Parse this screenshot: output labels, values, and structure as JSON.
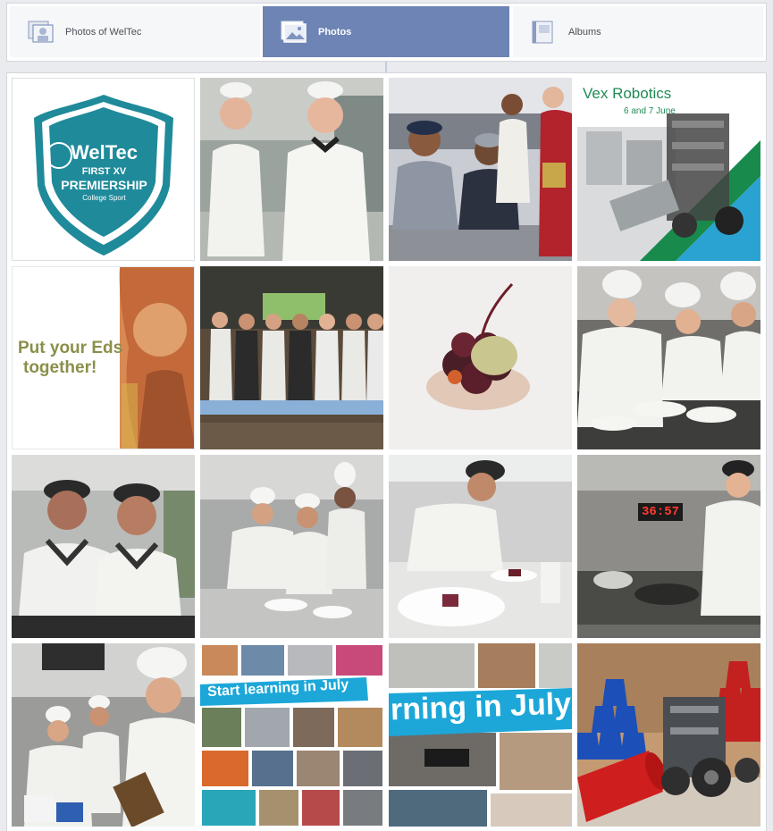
{
  "tabs": [
    {
      "label": "Photos of WelTec",
      "icon": "tagged-photos-icon",
      "active": false
    },
    {
      "label": "Photos",
      "icon": "photos-icon",
      "active": true
    },
    {
      "label": "Albums",
      "icon": "albums-icon",
      "active": false
    }
  ],
  "colors": {
    "accent": "#6d84b4",
    "teal": "#1f8a9a",
    "cyan": "#1ca7d8"
  },
  "photos": [
    {
      "title": "WelTec",
      "subtitle": "FIRST XV",
      "line3": "PREMIERSHIP",
      "line4": "College Sport"
    },
    {},
    {},
    {
      "title": "Vex Robotics",
      "subtitle": "6 and 7 June"
    },
    {
      "title": "Put your Eds",
      "subtitle": "together!"
    },
    {},
    {},
    {},
    {},
    {},
    {},
    {
      "clock": "36:57"
    },
    {},
    {
      "banner": "Start learning in July"
    },
    {
      "banner": "rning in July"
    },
    {}
  ]
}
